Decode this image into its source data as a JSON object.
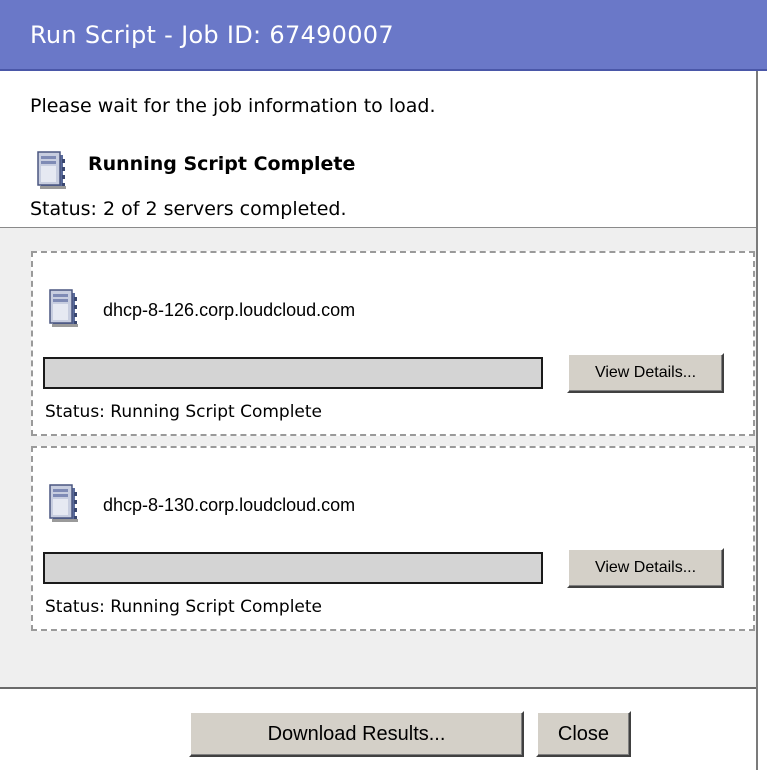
{
  "window": {
    "title": "Run Script - Job ID: 67490007"
  },
  "job": {
    "wait_message": "Please wait for the job information to load.",
    "summary_title": "Running Script Complete",
    "summary_status": "Status: 2 of 2 servers completed.",
    "summary_icon": "server-job-icon"
  },
  "servers": [
    {
      "icon": "server-icon",
      "hostname": "dhcp-8-126.corp.loudcloud.com",
      "details_label": "View Details...",
      "status": "Status: Running Script Complete",
      "progress": 0
    },
    {
      "icon": "server-icon",
      "hostname": "dhcp-8-130.corp.loudcloud.com",
      "details_label": "View Details...",
      "status": "Status: Running Script Complete",
      "progress": 0
    }
  ],
  "actions": {
    "download_label": "Download Results...",
    "close_label": "Close"
  },
  "colors": {
    "titlebar": "#6a78c8",
    "panel_bg": "#efefef",
    "button_face": "#d4d0c8",
    "progress_track": "#d4d4d4"
  }
}
